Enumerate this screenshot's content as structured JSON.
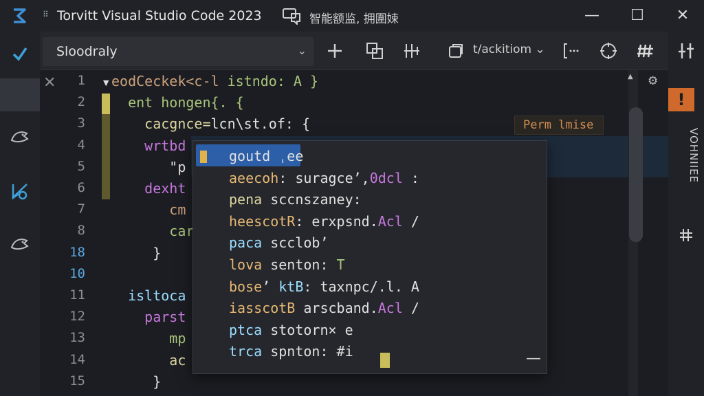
{
  "window": {
    "title": "Torvitt Visual Studio Code  2023",
    "note": "智能额监, 拥圍娕"
  },
  "toolbar": {
    "tab_label": "Sloodraly",
    "action_label": "t/ackitiom"
  },
  "right_rail": {
    "warn_badge": "!",
    "vertical_label": "VOHNIIEE"
  },
  "editor": {
    "line_numbers": [
      "1",
      "2",
      "3",
      "4",
      "5",
      "6",
      "7",
      "8",
      "18",
      "10",
      "11",
      "12",
      "13",
      "14",
      "15"
    ],
    "inline_hint": "Perm lmise",
    "code_lines": [
      [
        {
          "t": "eodCeckek<c-l ",
          "c": "k1"
        },
        {
          "t": "istndo: A }",
          "c": "k2"
        }
      ],
      [
        {
          "t": "  ent hongen{. {",
          "c": "k2"
        }
      ],
      [
        {
          "t": "    cacgnce=",
          "c": "k4"
        },
        {
          "t": "lcn\\st.of: {",
          "c": "k6"
        }
      ],
      [
        {
          "t": "    wrtbd",
          "c": "k3"
        }
      ],
      [
        {
          "t": "       \"p",
          "c": "k6"
        }
      ],
      [
        {
          "t": "    dexht",
          "c": "k3"
        }
      ],
      [
        {
          "t": "       cm",
          "c": "k1"
        }
      ],
      [
        {
          "t": "       car",
          "c": "k2"
        }
      ],
      [
        {
          "t": "     }",
          "c": "k6"
        }
      ],
      [
        {
          "t": "",
          "c": "k6"
        }
      ],
      [
        {
          "t": "  isltoca",
          "c": "k5"
        }
      ],
      [
        {
          "t": "    parst",
          "c": "k3"
        }
      ],
      [
        {
          "t": "       mp",
          "c": "k2"
        }
      ],
      [
        {
          "t": "       ac",
          "c": "k4"
        }
      ],
      [
        {
          "t": "     }",
          "c": "k6"
        }
      ]
    ]
  },
  "suggest": {
    "items": [
      [
        {
          "t": "goutd ",
          "c": "k6"
        },
        {
          "t": "ˌee",
          "c": "k6"
        }
      ],
      [
        {
          "t": "aeecoh",
          "c": "k8"
        },
        {
          "t": ": suragceʼ,",
          "c": "k6"
        },
        {
          "t": "0dcl",
          "c": "k3"
        },
        {
          "t": " :",
          "c": "k6"
        }
      ],
      [
        {
          "t": "pena ",
          "c": "k4"
        },
        {
          "t": "sccnszaney:",
          "c": "k6"
        }
      ],
      [
        {
          "t": "heescotR",
          "c": "k8"
        },
        {
          "t": ": erxpsnd.",
          "c": "k6"
        },
        {
          "t": "Acl",
          "c": "k3"
        },
        {
          "t": " /",
          "c": "k6"
        }
      ],
      [
        {
          "t": "paca ",
          "c": "k5"
        },
        {
          "t": "scclobʼ",
          "c": "k6"
        }
      ],
      [
        {
          "t": "lova ",
          "c": "k8"
        },
        {
          "t": "senton: ",
          "c": "k6"
        },
        {
          "t": "T",
          "c": "k2"
        }
      ],
      [
        {
          "t": "bose",
          "c": "k8"
        },
        {
          "t": "ʼ ",
          "c": "k6"
        },
        {
          "t": "ktB",
          "c": "k5"
        },
        {
          "t": ": taxnpc/.l. A",
          "c": "k6"
        }
      ],
      [
        {
          "t": "iasscotB",
          "c": "k8"
        },
        {
          "t": " arscband.",
          "c": "k6"
        },
        {
          "t": "Acl",
          "c": "k3"
        },
        {
          "t": " /",
          "c": "k6"
        }
      ],
      [
        {
          "t": "ptca ",
          "c": "k5"
        },
        {
          "t": "stotorn× e",
          "c": "k6"
        }
      ],
      [
        {
          "t": "trca ",
          "c": "k5"
        },
        {
          "t": "spnton: #i",
          "c": "k6"
        }
      ]
    ]
  },
  "colors": {
    "accent": "#2c5fa8",
    "warning": "#d06a2c",
    "modified": "#c9bd5b"
  },
  "icons": [
    "app-logo-icon",
    "grip-icon",
    "chat-icon",
    "minimize-icon",
    "maximize-icon",
    "close-icon",
    "explorer-check-icon",
    "bird-icon",
    "debug-icon",
    "plus-icon",
    "split-icon",
    "layout-icon",
    "copy-icon",
    "chevron-down-icon",
    "bracket-icon",
    "target-icon",
    "grid-icon",
    "sliders-icon",
    "gear-icon"
  ]
}
